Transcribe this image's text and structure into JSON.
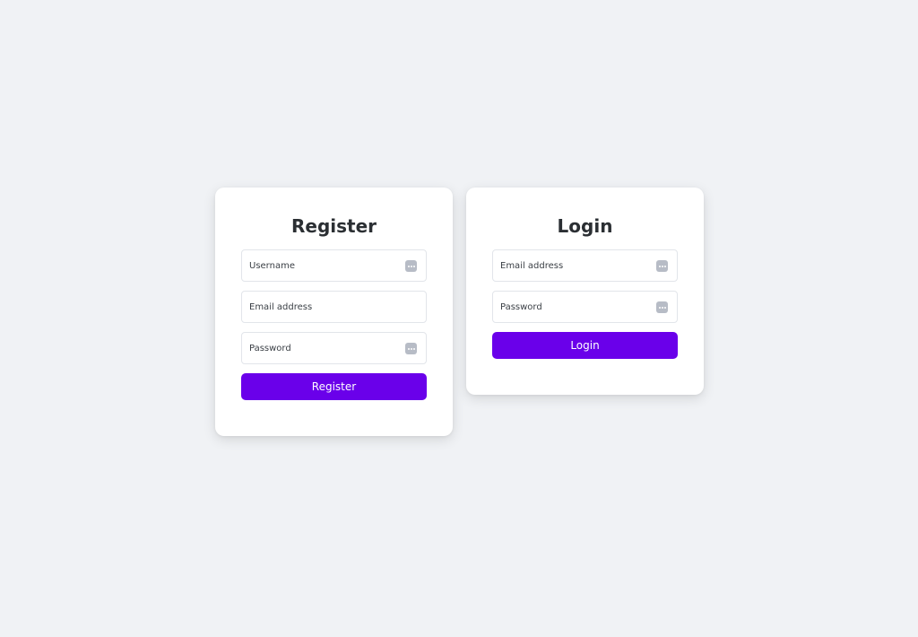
{
  "colors": {
    "page_background": "#f0f2f5",
    "card_background": "#ffffff",
    "accent": "#6a00ea",
    "title_text": "#2b2f33",
    "field_border": "#e2e5ea",
    "icon_fill": "#b7bcc6"
  },
  "register": {
    "title": "Register",
    "fields": [
      {
        "placeholder": "Username",
        "value": "",
        "icon": "password-manager-icon"
      },
      {
        "placeholder": "Email address",
        "value": "",
        "icon": ""
      },
      {
        "placeholder": "Password",
        "value": "",
        "icon": "password-manager-icon"
      }
    ],
    "submit_label": "Register"
  },
  "login": {
    "title": "Login",
    "fields": [
      {
        "placeholder": "Email address",
        "value": "",
        "icon": "password-manager-icon"
      },
      {
        "placeholder": "Password",
        "value": "",
        "icon": "password-manager-icon"
      }
    ],
    "submit_label": "Login"
  }
}
